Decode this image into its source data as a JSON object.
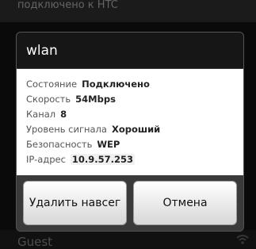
{
  "background": {
    "top_text": "подключено к HTC",
    "bottom_network": "Guest"
  },
  "dialog": {
    "title": "wlan",
    "rows": [
      {
        "label": "Состояние",
        "value": "Подключено"
      },
      {
        "label": "Скорость",
        "value": "54Mbps"
      },
      {
        "label": "Канал",
        "value": "8"
      },
      {
        "label": "Уровень сигнала",
        "value": "Хороший"
      },
      {
        "label": "Безопасность",
        "value": "WEP"
      },
      {
        "label": "IP-адрес",
        "value": "10.9.57.253"
      }
    ],
    "buttons": {
      "forget": "Удалить навсег",
      "cancel": "Отмена"
    }
  },
  "colors": {
    "title_bar": "#161616",
    "body": "#ffffff",
    "footer": "#3a3a3a",
    "button": "#e9e9e9"
  }
}
